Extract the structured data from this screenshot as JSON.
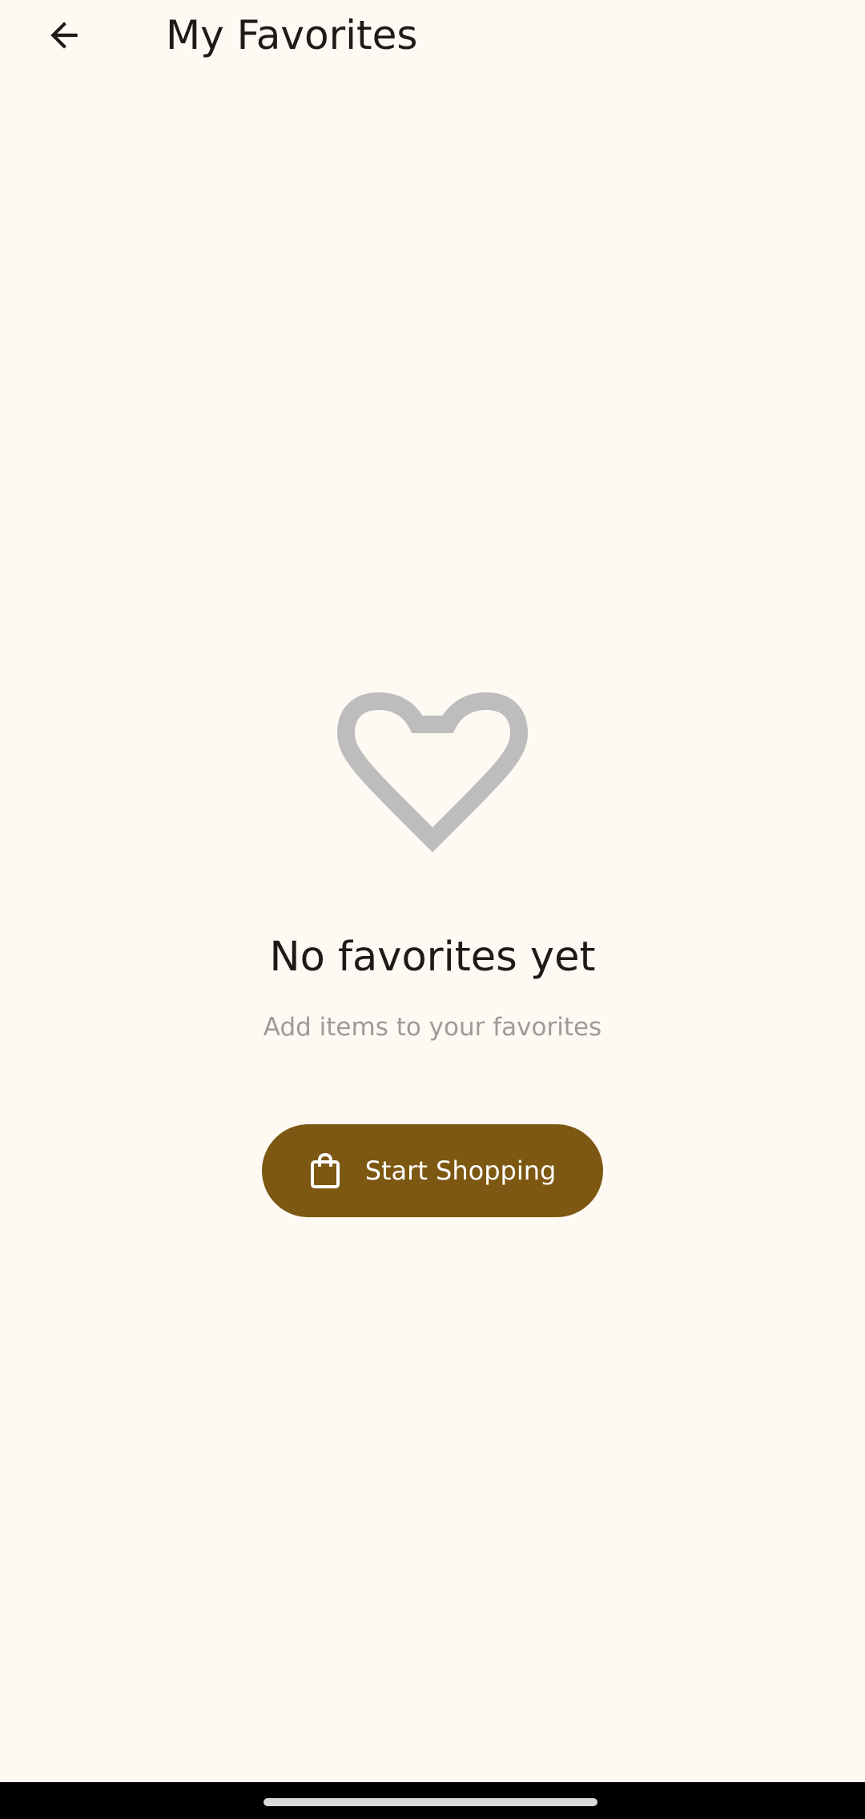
{
  "header": {
    "title": "My Favorites",
    "back_icon": "arrow-back-icon"
  },
  "empty_state": {
    "icon": "heart-outline-icon",
    "title": "No favorites yet",
    "subtitle": "Add items to your favorites"
  },
  "cta": {
    "label": "Start Shopping",
    "icon": "shopping-bag-icon"
  },
  "colors": {
    "background": "#FEF9F2",
    "accent": "#7D5812",
    "heart": "#BDBDBD",
    "text_primary": "#1F1A17",
    "text_secondary": "#9E9A95"
  }
}
